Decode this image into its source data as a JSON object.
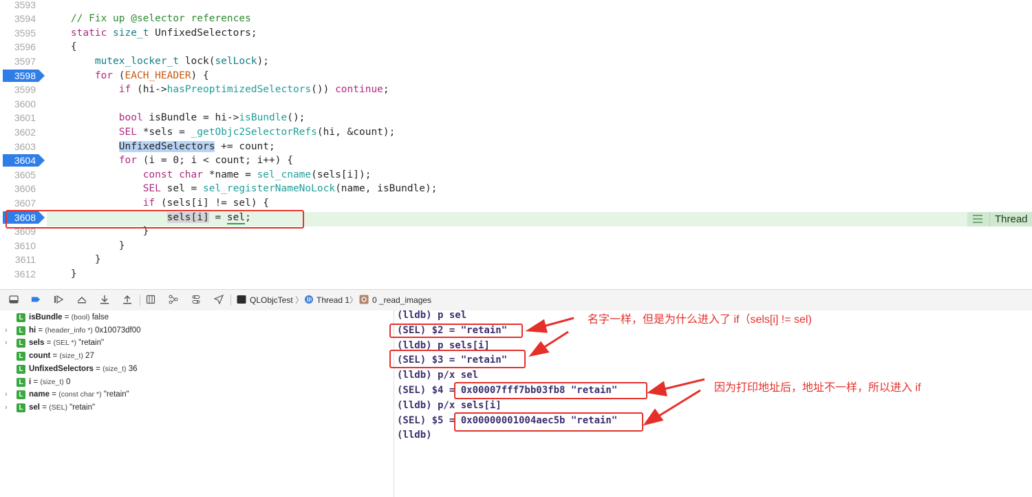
{
  "editor": {
    "lines": [
      {
        "num": "3593",
        "tokens": []
      },
      {
        "num": "3594",
        "tokens": [
          {
            "t": "    // Fix up @selector references",
            "c": "c"
          }
        ]
      },
      {
        "num": "3595",
        "tokens": [
          {
            "t": "    ",
            "c": ""
          },
          {
            "t": "static",
            "c": "k"
          },
          {
            "t": " ",
            "c": ""
          },
          {
            "t": "size_t",
            "c": "t"
          },
          {
            "t": " UnfixedSelectors;",
            "c": ""
          }
        ]
      },
      {
        "num": "3596",
        "tokens": [
          {
            "t": "    {",
            "c": ""
          }
        ]
      },
      {
        "num": "3597",
        "tokens": [
          {
            "t": "        ",
            "c": ""
          },
          {
            "t": "mutex_locker_t",
            "c": "t"
          },
          {
            "t": " lock(",
            "c": ""
          },
          {
            "t": "selLock",
            "c": "t"
          },
          {
            "t": ");",
            "c": ""
          }
        ]
      },
      {
        "num": "3598",
        "bp": true,
        "tokens": [
          {
            "t": "        ",
            "c": ""
          },
          {
            "t": "for",
            "c": "k"
          },
          {
            "t": " (",
            "c": ""
          },
          {
            "t": "EACH_HEADER",
            "c": "m"
          },
          {
            "t": ") {",
            "c": ""
          }
        ]
      },
      {
        "num": "3599",
        "tokens": [
          {
            "t": "            ",
            "c": ""
          },
          {
            "t": "if",
            "c": "k"
          },
          {
            "t": " (hi->",
            "c": ""
          },
          {
            "t": "hasPreoptimizedSelectors",
            "c": "f"
          },
          {
            "t": "()) ",
            "c": ""
          },
          {
            "t": "continue",
            "c": "k"
          },
          {
            "t": ";",
            "c": ""
          }
        ]
      },
      {
        "num": "3600",
        "tokens": []
      },
      {
        "num": "3601",
        "tokens": [
          {
            "t": "            ",
            "c": ""
          },
          {
            "t": "bool",
            "c": "k"
          },
          {
            "t": " isBundle = hi->",
            "c": ""
          },
          {
            "t": "isBundle",
            "c": "f"
          },
          {
            "t": "();",
            "c": ""
          }
        ]
      },
      {
        "num": "3602",
        "tokens": [
          {
            "t": "            ",
            "c": ""
          },
          {
            "t": "SEL",
            "c": "k"
          },
          {
            "t": " *sels = ",
            "c": ""
          },
          {
            "t": "_getObjc2SelectorRefs",
            "c": "f"
          },
          {
            "t": "(hi, &count);",
            "c": ""
          }
        ]
      },
      {
        "num": "3603",
        "tokens": [
          {
            "t": "            ",
            "c": ""
          },
          {
            "t": "UnfixedSelectors",
            "c": "hl-sel"
          },
          {
            "t": " += count;",
            "c": ""
          }
        ]
      },
      {
        "num": "3604",
        "bp": true,
        "tokens": [
          {
            "t": "            ",
            "c": ""
          },
          {
            "t": "for",
            "c": "k"
          },
          {
            "t": " (i = 0; i < count; i++) {",
            "c": ""
          }
        ]
      },
      {
        "num": "3605",
        "tokens": [
          {
            "t": "                ",
            "c": ""
          },
          {
            "t": "const",
            "c": "k"
          },
          {
            "t": " ",
            "c": ""
          },
          {
            "t": "char",
            "c": "k"
          },
          {
            "t": " *name = ",
            "c": ""
          },
          {
            "t": "sel_cname",
            "c": "f"
          },
          {
            "t": "(sels[i]);",
            "c": ""
          }
        ]
      },
      {
        "num": "3606",
        "tokens": [
          {
            "t": "                ",
            "c": ""
          },
          {
            "t": "SEL",
            "c": "k"
          },
          {
            "t": " sel = ",
            "c": ""
          },
          {
            "t": "sel_registerNameNoLock",
            "c": "f"
          },
          {
            "t": "(name, isBundle);",
            "c": ""
          }
        ]
      },
      {
        "num": "3607",
        "tokens": [
          {
            "t": "                ",
            "c": ""
          },
          {
            "t": "if",
            "c": "k"
          },
          {
            "t": " (sels[i] != sel) {",
            "c": ""
          }
        ]
      },
      {
        "num": "3608",
        "bp": true,
        "tokens": [
          {
            "t": "                    ",
            "c": ""
          },
          {
            "t": "sels[i]",
            "c": "hl-gray"
          },
          {
            "t": " = ",
            "c": ""
          },
          {
            "t": "sel",
            "c": "ul"
          },
          {
            "t": ";",
            "c": ""
          }
        ]
      },
      {
        "num": "3609",
        "tokens": [
          {
            "t": "                }",
            "c": ""
          }
        ]
      },
      {
        "num": "3610",
        "tokens": [
          {
            "t": "            }",
            "c": ""
          }
        ]
      },
      {
        "num": "3611",
        "tokens": [
          {
            "t": "        }",
            "c": ""
          }
        ]
      },
      {
        "num": "3612",
        "tokens": [
          {
            "t": "    }",
            "c": ""
          }
        ]
      }
    ],
    "thread_badge": "Thread"
  },
  "debugbar": {
    "target": "QLObjcTest",
    "thread": "Thread 1",
    "frame": "0 _read_images"
  },
  "variables": [
    {
      "expand": false,
      "name": "isBundle",
      "type": "(bool)",
      "value": "false"
    },
    {
      "expand": true,
      "name": "hi",
      "type": "(header_info *)",
      "value": "0x10073df00"
    },
    {
      "expand": true,
      "name": "sels",
      "type": "(SEL *)",
      "value": "\"retain\""
    },
    {
      "expand": false,
      "name": "count",
      "type": "(size_t)",
      "value": "27"
    },
    {
      "expand": false,
      "name": "UnfixedSelectors",
      "type": "(size_t)",
      "value": "36"
    },
    {
      "expand": false,
      "name": "i",
      "type": "(size_t)",
      "value": "0"
    },
    {
      "expand": true,
      "name": "name",
      "type": "(const char *)",
      "value": "\"retain\""
    },
    {
      "expand": true,
      "name": "sel",
      "type": "(SEL)",
      "value": "\"retain\""
    }
  ],
  "console": [
    "(lldb) p sel",
    "(SEL) $2 = \"retain\"",
    "(lldb) p sels[i]",
    "(SEL) $3 = \"retain\"",
    "(lldb) p/x sel",
    "(SEL) $4 = 0x00007fff7bb03fb8 \"retain\"",
    "(lldb) p/x sels[i]",
    "(SEL) $5 = 0x00000001004aec5b \"retain\"",
    "(lldb)"
  ],
  "annotations": {
    "note1": "名字一样，但是为什么进入了 if（sels[i] != sel)",
    "note2": "因为打印地址后，地址不一样，所以进入 if"
  },
  "colors": {
    "breakpoint": "#2f7ee8",
    "annotation": "#e5302a",
    "current_line": "#e6f4e6"
  }
}
